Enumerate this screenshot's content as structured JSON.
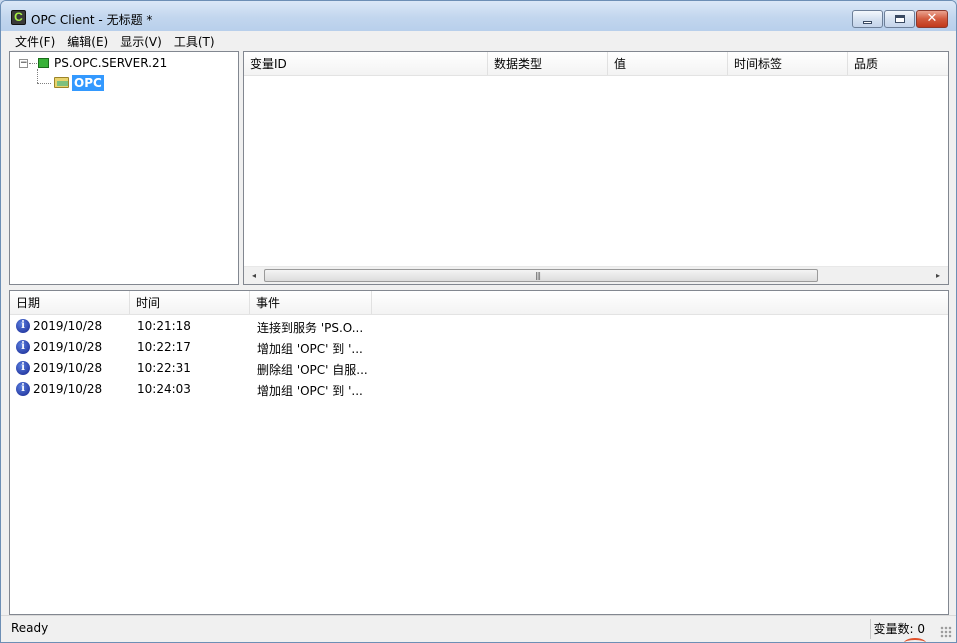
{
  "window": {
    "title": "OPC Client - 无标题 *",
    "icon_letter": "C"
  },
  "menu": [
    {
      "label": "文件(F)"
    },
    {
      "label": "编辑(E)"
    },
    {
      "label": "显示(V)"
    },
    {
      "label": "工具(T)"
    }
  ],
  "tree": {
    "expander": "⊟",
    "server": "PS.OPC.SERVER.21",
    "group": "OPC"
  },
  "variables": {
    "columns": [
      "变量ID",
      "数据类型",
      "值",
      "时间标签",
      "品质"
    ]
  },
  "scrollbar": {
    "left_arrow": "◂",
    "right_arrow": "▸",
    "grip": "|||"
  },
  "log": {
    "columns": [
      "日期",
      "时间",
      "事件"
    ],
    "rows": [
      {
        "date": "2019/10/28",
        "time": "10:21:18",
        "event": "连接到服务 'PS.O..."
      },
      {
        "date": "2019/10/28",
        "time": "10:22:17",
        "event": "增加组 'OPC' 到 '..."
      },
      {
        "date": "2019/10/28",
        "time": "10:22:31",
        "event": "删除组 'OPC' 自服..."
      },
      {
        "date": "2019/10/28",
        "time": "10:24:03",
        "event": "增加组 'OPC' 到 '..."
      }
    ]
  },
  "status": {
    "text": "Ready",
    "count": "变量数: 0"
  },
  "colors": {
    "selection": "#3399ff",
    "info_icon": "#16258f"
  }
}
